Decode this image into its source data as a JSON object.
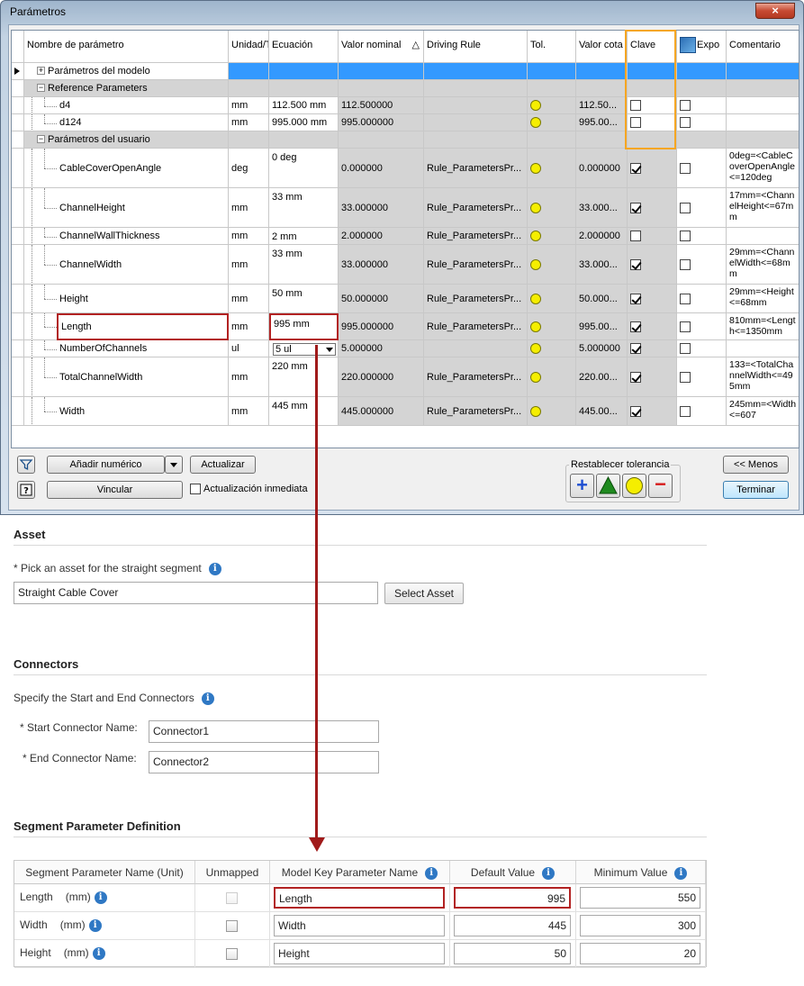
{
  "dialog": {
    "title": "Parámetros",
    "close_glyph": "×",
    "columns": [
      "Nombre de parámetro",
      "Unidad/T",
      "Ecuación",
      "Valor nominal",
      "Driving Rule",
      "Tol.",
      "Valor cota",
      "Clave",
      "Expo",
      "Comentario"
    ],
    "sort_glyph": "△",
    "groups": {
      "model": "Parámetros del modelo",
      "reference": "Reference Parameters",
      "user": "Parámetros del usuario"
    },
    "reference_rows": [
      {
        "name": "d4",
        "unit": "mm",
        "equation": "112.500 mm",
        "nominal": "112.500000",
        "rule": "",
        "value": "112.50...",
        "key": false,
        "export": false,
        "comment": ""
      },
      {
        "name": "d124",
        "unit": "mm",
        "equation": "995.000 mm",
        "nominal": "995.000000",
        "rule": "",
        "value": "995.00...",
        "key": false,
        "export": false,
        "comment": ""
      }
    ],
    "user_rows": [
      {
        "name": "CableCoverOpenAngle",
        "unit": "deg",
        "equation": "0 deg",
        "nominal": "0.000000",
        "rule": "Rule_ParametersPr...",
        "value": "0.000000",
        "key": true,
        "export": false,
        "comment": "0deg=<CableCoverOpenAngle<=120deg"
      },
      {
        "name": "ChannelHeight",
        "unit": "mm",
        "equation": "33 mm",
        "nominal": "33.000000",
        "rule": "Rule_ParametersPr...",
        "value": "33.000...",
        "key": true,
        "export": false,
        "comment": "17mm=<ChannelHeight<=67mm"
      },
      {
        "name": "ChannelWallThickness",
        "unit": "mm",
        "equation": "2 mm",
        "nominal": "2.000000",
        "rule": "Rule_ParametersPr...",
        "value": "2.000000",
        "key": false,
        "export": false,
        "comment": ""
      },
      {
        "name": "ChannelWidth",
        "unit": "mm",
        "equation": "33 mm",
        "nominal": "33.000000",
        "rule": "Rule_ParametersPr...",
        "value": "33.000...",
        "key": true,
        "export": false,
        "comment": "29mm=<ChannelWidth<=68mm"
      },
      {
        "name": "Height",
        "unit": "mm",
        "equation": "50 mm",
        "nominal": "50.000000",
        "rule": "Rule_ParametersPr...",
        "value": "50.000...",
        "key": true,
        "export": false,
        "comment": "29mm=<Height<=68mm"
      },
      {
        "name": "Length",
        "unit": "mm",
        "equation": "995 mm",
        "nominal": "995.000000",
        "rule": "Rule_ParametersPr...",
        "value": "995.00...",
        "key": true,
        "export": false,
        "comment": "810mm=<Length<=1350mm"
      },
      {
        "name": "NumberOfChannels",
        "unit": "ul",
        "equation": "5 ul",
        "nominal": "5.000000",
        "rule": "",
        "value": "5.000000",
        "key": true,
        "export": false,
        "comment": ""
      },
      {
        "name": "TotalChannelWidth",
        "unit": "mm",
        "equation": "220 mm",
        "nominal": "220.000000",
        "rule": "Rule_ParametersPr...",
        "value": "220.00...",
        "key": true,
        "export": false,
        "comment": "133=<TotalChannelWidth<=495mm"
      },
      {
        "name": "Width",
        "unit": "mm",
        "equation": "445 mm",
        "nominal": "445.000000",
        "rule": "Rule_ParametersPr...",
        "value": "445.00...",
        "key": true,
        "export": false,
        "comment": "245mm=<Width<=607"
      }
    ],
    "buttons": {
      "add_numeric": "Añadir numérico",
      "update": "Actualizar",
      "link": "Vincular",
      "immediate_update": "Actualización inmediata",
      "less": "<< Menos",
      "finish": "Terminar",
      "reset_tolerance": "Restablecer tolerancia",
      "plus_glyph": "+",
      "minus_glyph": "−"
    }
  },
  "asset": {
    "title": "Asset",
    "prompt": "* Pick an asset for the straight segment",
    "value": "Straight Cable Cover",
    "button": "Select Asset"
  },
  "connectors": {
    "title": "Connectors",
    "prompt": "Specify the Start and End Connectors",
    "start_label": "* Start Connector Name:",
    "start_value": "Connector1",
    "end_label": "* End Connector Name:",
    "end_value": "Connector2"
  },
  "segment": {
    "title": "Segment Parameter Definition",
    "headers": [
      "Segment Parameter Name (Unit)",
      "Unmapped",
      "Model Key Parameter Name",
      "Default Value",
      "Minimum Value"
    ],
    "rows": [
      {
        "name": "Length",
        "unit": "(mm)",
        "key": "Length",
        "default": "995",
        "min": "550"
      },
      {
        "name": "Width",
        "unit": "(mm)",
        "key": "Width",
        "default": "445",
        "min": "300"
      },
      {
        "name": "Height",
        "unit": "(mm)",
        "key": "Height",
        "default": "50",
        "min": "20"
      }
    ]
  },
  "info_glyph": "i",
  "colors": {
    "accent": "#3399ff",
    "highlight": "#b22222",
    "arrow": "#a01a1a",
    "key_column": "#f5a623",
    "tolerance": "#f5ee00"
  }
}
